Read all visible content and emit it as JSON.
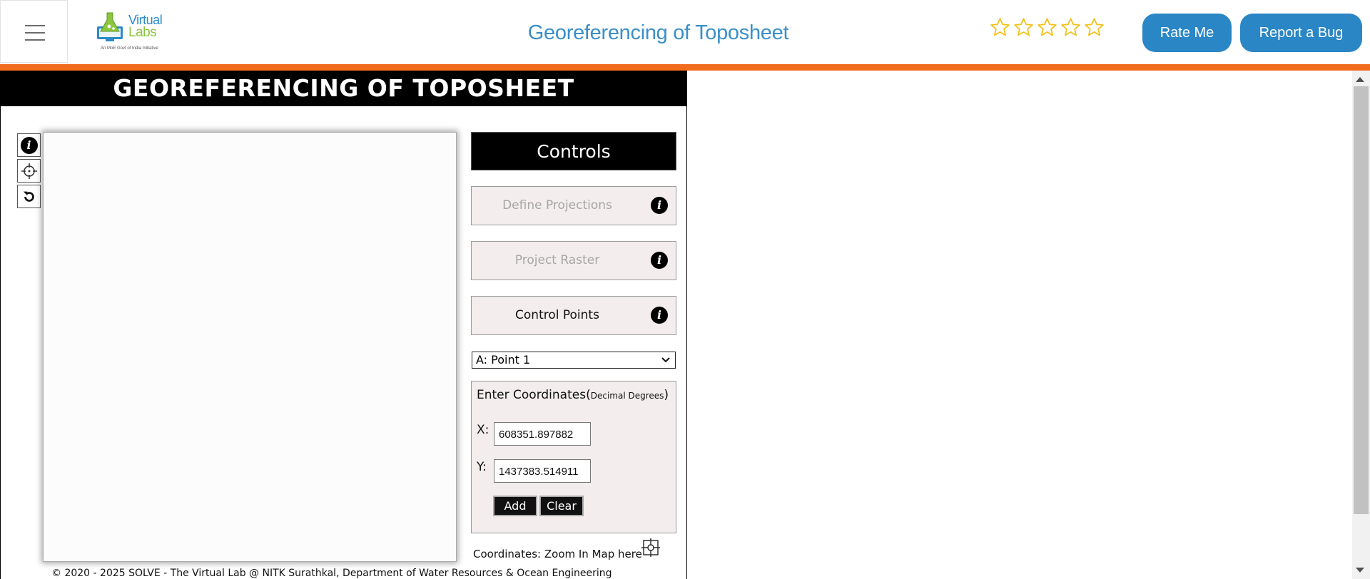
{
  "header": {
    "menu_icon": "hamburger-icon",
    "logo": {
      "line1": "Virtual",
      "line2": "Labs",
      "tagline": "An MoE Govt of India Initiative"
    },
    "title": "Georeferencing of Toposheet",
    "rating": {
      "stars": 5,
      "filled": 0,
      "star_color": "#f2c21a"
    },
    "rate_label": "Rate Me",
    "bug_label": "Report a Bug",
    "accent_color": "#2a86c5",
    "divider_color": "#f26c1e"
  },
  "sim": {
    "title": "GEOREFERENCING OF TOPOSHEET",
    "tools": [
      "info-icon",
      "crosshair-icon",
      "reset-icon"
    ],
    "controls": {
      "heading": "Controls",
      "buttons": [
        {
          "label": "Define Projections",
          "state": "disabled"
        },
        {
          "label": "Project Raster",
          "state": "disabled"
        },
        {
          "label": "Control Points",
          "state": "active"
        }
      ],
      "point_select": {
        "value": "A: Point 1"
      },
      "coordinates": {
        "title": "Enter Coordinates(",
        "unit": "Decimal Degrees",
        "close": ")",
        "x_label": "X:",
        "x_value": "608351.897882",
        "y_label": "Y:",
        "y_value": "1437383.514911",
        "add_label": "Add",
        "clear_label": "Clear"
      },
      "coords_readout": "Coordinates: Zoom In Map here"
    },
    "footer": "© 2020 - 2025 SOLVE - The Virtual Lab @ NITK Surathkal, Department of Water Resources & Ocean Engineering"
  }
}
